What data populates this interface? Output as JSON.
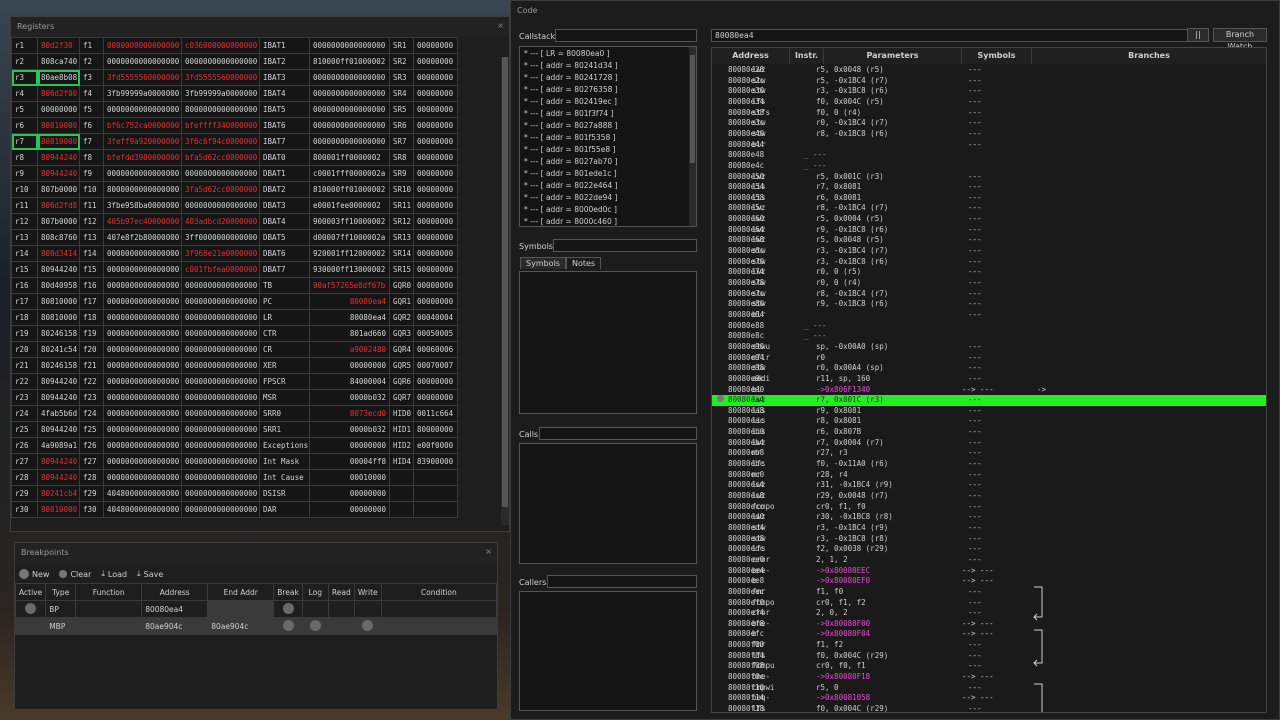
{
  "registers": {
    "title": "Registers",
    "rows": [
      [
        "r1",
        "80d2f30",
        "f1",
        "0000000000000000",
        "c036000000000000",
        "IBAT1",
        "0000000000000000",
        "SR1",
        "00000000"
      ],
      [
        "r2",
        "808ca740",
        "f2",
        "0000000000000000",
        "0000000000000000",
        "IBAT2",
        "810000ff01000002",
        "SR2",
        "00000000"
      ],
      [
        "r3",
        "80ae8b08",
        "f3",
        "3fd5555560000000",
        "3fd5555560000000",
        "IBAT3",
        "0000000000000000",
        "SR3",
        "00000000"
      ],
      [
        "r4",
        "806d2f00",
        "f4",
        "3fb99999a0000000",
        "3fb99999a0000000",
        "IBAT4",
        "0000000000000000",
        "SR4",
        "00000000"
      ],
      [
        "r5",
        "00000000",
        "f5",
        "0000000000000000",
        "8000000000000000",
        "IBAT5",
        "0000000000000000",
        "SR5",
        "00000000"
      ],
      [
        "r6",
        "80810000",
        "f6",
        "bf6c752ca0000000",
        "bfeffff340000000",
        "IBAT6",
        "0000000000000000",
        "SR6",
        "00000000"
      ],
      [
        "r7",
        "80810000",
        "f7",
        "3feff9a920000000",
        "3f6c6f94c0000000",
        "IBAT7",
        "0000000000000000",
        "SR7",
        "00000000"
      ],
      [
        "r8",
        "80944240",
        "f8",
        "bfefdd3980000000",
        "bfa5d62cc0000000",
        "DBAT0",
        "800001ff0000002",
        "SR8",
        "00000000"
      ],
      [
        "r9",
        "80944240",
        "f9",
        "0000000000000000",
        "0000000000000000",
        "DBAT1",
        "c0001fff0000002a",
        "SR9",
        "00000000"
      ],
      [
        "r10",
        "807b0000",
        "f10",
        "8000000000000000",
        "3fa5d62cc0000000",
        "DBAT2",
        "810000ff01000002",
        "SR10",
        "00000000"
      ],
      [
        "r11",
        "806d2fd8",
        "f11",
        "3fbe958ba0000000",
        "0000000000000000",
        "DBAT3",
        "e0001fee0000002",
        "SR11",
        "00000000"
      ],
      [
        "r12",
        "807b0000",
        "f12",
        "405b97ec40000000",
        "403adbcd20000000",
        "DBAT4",
        "900003ff10000002",
        "SR12",
        "00000000"
      ],
      [
        "r13",
        "808c8760",
        "f13",
        "407e8f2b80000000",
        "3ff0000000000000",
        "DBAT5",
        "d00007ff1000002a",
        "SR13",
        "00000000"
      ],
      [
        "r14",
        "808d3414",
        "f14",
        "0000000000000000",
        "3f968e21e0000000",
        "DBAT6",
        "920001ff12000002",
        "SR14",
        "00000000"
      ],
      [
        "r15",
        "80944240",
        "f15",
        "0000000000000000",
        "c001fbfea0000000",
        "DBAT7",
        "930000ff13000002",
        "SR15",
        "00000000"
      ],
      [
        "r16",
        "80d40958",
        "f16",
        "0000000000000000",
        "0000000000000000",
        "TB",
        "00af57265e8df67b",
        "GQR0",
        "00000000"
      ],
      [
        "r17",
        "80810000",
        "f17",
        "0000000000000000",
        "0000000000000000",
        "PC",
        "80080ea4",
        "GQR1",
        "00000000"
      ],
      [
        "r18",
        "80810000",
        "f18",
        "0000000000000000",
        "0000000000000000",
        "LR",
        "80080ea4",
        "GQR2",
        "00040004"
      ],
      [
        "r19",
        "80246158",
        "f19",
        "0000000000000000",
        "0000000000000000",
        "CTR",
        "801ad660",
        "GQR3",
        "00050005"
      ],
      [
        "r20",
        "80241c54",
        "f20",
        "0000000000000000",
        "0000000000000000",
        "CR",
        "a9002480",
        "GQR4",
        "00060006"
      ],
      [
        "r21",
        "80246158",
        "f21",
        "0000000000000000",
        "0000000000000000",
        "XER",
        "00000000",
        "GQR5",
        "00070007"
      ],
      [
        "r22",
        "80944240",
        "f22",
        "0000000000000000",
        "0000000000000000",
        "FPSCR",
        "84000004",
        "GQR6",
        "00000000"
      ],
      [
        "r23",
        "80944240",
        "f23",
        "0000000000000000",
        "0000000000000000",
        "MSR",
        "0000b032",
        "GQR7",
        "00000000"
      ],
      [
        "r24",
        "4fab5b6d",
        "f24",
        "0000000000000000",
        "0000000000000000",
        "SRR0",
        "8073ecd0",
        "HID0",
        "0011c664"
      ],
      [
        "r25",
        "80944240",
        "f25",
        "0000000000000000",
        "0000000000000000",
        "SRR1",
        "0000b032",
        "HID1",
        "80000000"
      ],
      [
        "r26",
        "4a9089a1",
        "f26",
        "0000000000000000",
        "0000000000000000",
        "Exceptions",
        "00000000",
        "HID2",
        "e00f0000"
      ],
      [
        "r27",
        "80944240",
        "f27",
        "0000000000000000",
        "0000000000000000",
        "Int Mask",
        "00004ff8",
        "HID4",
        "83900000"
      ],
      [
        "r28",
        "80944240",
        "f28",
        "0000000000000000",
        "0000000000000000",
        "Int Cause",
        "00010000",
        "",
        ""
      ],
      [
        "r29",
        "80241cb4",
        "f29",
        "4048000000000000",
        "0000000000000000",
        "DSISR",
        "00000000",
        "",
        ""
      ],
      [
        "r30",
        "80810000",
        "f30",
        "4048000000000000",
        "0000000000000000",
        "DAR",
        "00000000",
        "",
        ""
      ]
    ],
    "red_cells": [
      "0:1",
      "0:3",
      "0:4",
      "2:3",
      "2:4",
      "3:1",
      "5:1",
      "5:3",
      "5:4",
      "6:1",
      "6:3",
      "6:4",
      "7:1",
      "7:3",
      "7:4",
      "8:1",
      "9:4",
      "10:1",
      "11:3",
      "11:4",
      "13:1",
      "13:4",
      "14:4",
      "15:6",
      "16:6",
      "19:6",
      "23:6",
      "26:1",
      "27:1",
      "28:1",
      "29:1"
    ],
    "highlighted_cells": [
      "2:0",
      "2:1",
      "6:0",
      "6:1"
    ]
  },
  "breakpoints": {
    "title": "Breakpoints",
    "toolbar": {
      "new": "New",
      "clear": "Clear",
      "load": "Load",
      "save": "Save"
    },
    "headers": [
      "Active",
      "Type",
      "Function",
      "Address",
      "End Addr",
      "Break",
      "Log",
      "Read",
      "Write",
      "Condition"
    ],
    "rows": [
      {
        "type": "BP",
        "function": "",
        "address": "80080ea4",
        "end": ""
      },
      {
        "type": "MBP",
        "function": "",
        "address": "80ae904c",
        "end": "80ae904c"
      }
    ]
  },
  "code": {
    "title": "Code",
    "address_input": "80080ea4",
    "pause_label": "||",
    "branch_watch_label": "Branch Watch",
    "callstack_label": "Callstack",
    "callstack_items": [
      "* --- [ LR = 80080ea0 ]",
      "* --- [ addr = 80241d34 ]",
      "* --- [ addr = 80241728 ]",
      "* --- [ addr = 80276358 ]",
      "* --- [ addr = 802419ec ]",
      "* --- [ addr = 801f3f74 ]",
      "* --- [ addr = 8027a888 ]",
      "* --- [ addr = 801f5358 ]",
      "* --- [ addr = 801f55e8 ]",
      "* --- [ addr = 8027ab70 ]",
      "* --- [ addr = 801ede1c ]",
      "* --- [ addr = 8022e464 ]",
      "* --- [ addr = 8022de94 ]",
      "* --- [ addr = 8000ed0c ]",
      "* --- [ addr = 8000c460 ]"
    ],
    "symbols_label": "Symbols",
    "tab_symbols": "Symbols",
    "tab_notes": "Notes",
    "calls_label": "Calls",
    "callers_label": "Callers",
    "columns": [
      "Address",
      "Instr.",
      "Parameters",
      "Symbols",
      "Branches"
    ],
    "rows": [
      [
        "80080e28",
        "lwz",
        "r5, 0x0048 (r5)",
        "---",
        ""
      ],
      [
        "80080e2c",
        "stw",
        "r5, -0x1BC4 (r7)",
        "---",
        ""
      ],
      [
        "80080e30",
        "stw",
        "r3, -0x1BC8 (r6)",
        "---",
        ""
      ],
      [
        "80080e34",
        "lfs",
        "f0, 0x004C (r5)",
        "---",
        ""
      ],
      [
        "80080e38",
        "stfs",
        "f0, 0 (r4)",
        "---",
        ""
      ],
      [
        "80080e3c",
        "stw",
        "r0, -0x1BC4 (r7)",
        "---",
        ""
      ],
      [
        "80080e40",
        "stw",
        "r8, -0x1BC8 (r6)",
        "---",
        ""
      ],
      [
        "80080e44",
        "blr",
        "",
        "---",
        ""
      ],
      [
        "80080e48",
        "",
        "_ ---",
        "",
        ""
      ],
      [
        "80080e4c",
        "",
        "_ ---",
        "",
        ""
      ],
      [
        "80080e50",
        "lwz",
        "r5, 0x001C (r3)",
        "---",
        ""
      ],
      [
        "80080e54",
        "lis",
        "r7, 0x8081",
        "---",
        ""
      ],
      [
        "80080e58",
        "lis",
        "r6, 0x8081",
        "---",
        ""
      ],
      [
        "80080e5c",
        "lwz",
        "r8, -0x1BC4 (r7)",
        "---",
        ""
      ],
      [
        "80080e60",
        "lwz",
        "r5, 0x0004 (r5)",
        "---",
        ""
      ],
      [
        "80080e64",
        "lwz",
        "r9, -0x1BC8 (r6)",
        "---",
        ""
      ],
      [
        "80080e68",
        "lwz",
        "r5, 0x0048 (r5)",
        "---",
        ""
      ],
      [
        "80080e6c",
        "stw",
        "r3, -0x1BC4 (r7)",
        "---",
        ""
      ],
      [
        "80080e70",
        "stw",
        "r3, -0x1BC8 (r6)",
        "---",
        ""
      ],
      [
        "80080e74",
        "lwz",
        "r0, 0 (r5)",
        "---",
        ""
      ],
      [
        "80080e78",
        "stw",
        "r0, 0 (r4)",
        "---",
        ""
      ],
      [
        "80080e7c",
        "stw",
        "r8, -0x1BC4 (r7)",
        "---",
        ""
      ],
      [
        "80080e80",
        "stw",
        "r9, -0x1BC8 (r6)",
        "---",
        ""
      ],
      [
        "80080e84",
        "blr",
        "",
        "---",
        ""
      ],
      [
        "80080e88",
        "",
        "_ ---",
        "",
        ""
      ],
      [
        "80080e8c",
        "",
        "_ ---",
        "",
        ""
      ],
      [
        "80080e90",
        "stwu",
        "sp, -0x00A0 (sp)",
        "---",
        ""
      ],
      [
        "80080e94",
        "mflr",
        "r0",
        "---",
        ""
      ],
      [
        "80080e98",
        "stw",
        "r0, 0x00A4 (sp)",
        "---",
        ""
      ],
      [
        "80080e9c",
        "addi",
        "r11, sp, 160",
        "---",
        ""
      ],
      [
        "80080ea0",
        "bl",
        "->0x806F1340",
        "--> ---",
        "->"
      ],
      [
        "80080ea4",
        "lwz",
        "r7, 0x001C (r3)",
        "---",
        ""
      ],
      [
        "80080ea8",
        "lis",
        "r9, 0x8081",
        "---",
        ""
      ],
      [
        "80080eac",
        "lis",
        "r8, 0x8081",
        "---",
        ""
      ],
      [
        "80080eb0",
        "lis",
        "r6, 0x807B",
        "---",
        ""
      ],
      [
        "80080eb4",
        "lwz",
        "r7, 0x0004 (r7)",
        "---",
        ""
      ],
      [
        "80080eb8",
        "mr",
        "r27, r3",
        "---",
        ""
      ],
      [
        "80080ebc",
        "lfs",
        "f0, -0x11A0 (r6)",
        "---",
        ""
      ],
      [
        "80080ec0",
        "mr",
        "r28, r4",
        "---",
        ""
      ],
      [
        "80080ec4",
        "lwz",
        "r31, -0x1BC4 (r9)",
        "---",
        ""
      ],
      [
        "80080ec8",
        "lwz",
        "r29, 0x0048 (r7)",
        "---",
        ""
      ],
      [
        "80080ecc",
        "fcmpo",
        "cr0, f1, f0",
        "---",
        ""
      ],
      [
        "80080ed0",
        "lwz",
        "r30, -0x1BC8 (r8)",
        "---",
        ""
      ],
      [
        "80080ed4",
        "stw",
        "r3, -0x1BC4 (r9)",
        "---",
        ""
      ],
      [
        "80080ed8",
        "stw",
        "r3, -0x1BC8 (r8)",
        "---",
        ""
      ],
      [
        "80080edc",
        "lfs",
        "f2, 0x0038 (r29)",
        "---",
        ""
      ],
      [
        "80080ee0",
        "cror",
        "2, 1, 2",
        "---",
        ""
      ],
      [
        "80080ee4",
        "bne-",
        "->0x80080EEC",
        "--> ---",
        ""
      ],
      [
        "80080ee8",
        "b",
        "->0x80080EF0",
        "--> ---",
        ""
      ],
      [
        "80080eec",
        "fmr",
        "f1, f0",
        "---",
        ""
      ],
      [
        "80080ef0",
        "fcmpo",
        "cr0, f1, f2",
        "---",
        ""
      ],
      [
        "80080ef4",
        "cror",
        "2, 0, 2",
        "---",
        ""
      ],
      [
        "80080ef8",
        "bne-",
        "->0x80080F00",
        "--> ---",
        ""
      ],
      [
        "80080efc",
        "b",
        "->0x80080F04",
        "--> ---",
        ""
      ],
      [
        "80080f00",
        "fmr",
        "f1, f2",
        "---",
        ""
      ],
      [
        "80080f04",
        "lfs",
        "f0, 0x004C (r29)",
        "---",
        ""
      ],
      [
        "80080f08",
        "fcmpu",
        "cr0, f0, f1",
        "---",
        ""
      ],
      [
        "80080f0c",
        "bne-",
        "->0x80080F18",
        "--> ---",
        ""
      ],
      [
        "80080f10",
        "cmpwi",
        "r5, 0",
        "---",
        ""
      ],
      [
        "80080f14",
        "beq-",
        "->0x80081058",
        "--> ---",
        ""
      ],
      [
        "80080f18",
        "lfs",
        "f0, 0x004C (r29)",
        "---",
        ""
      ]
    ],
    "current_index": 31
  }
}
